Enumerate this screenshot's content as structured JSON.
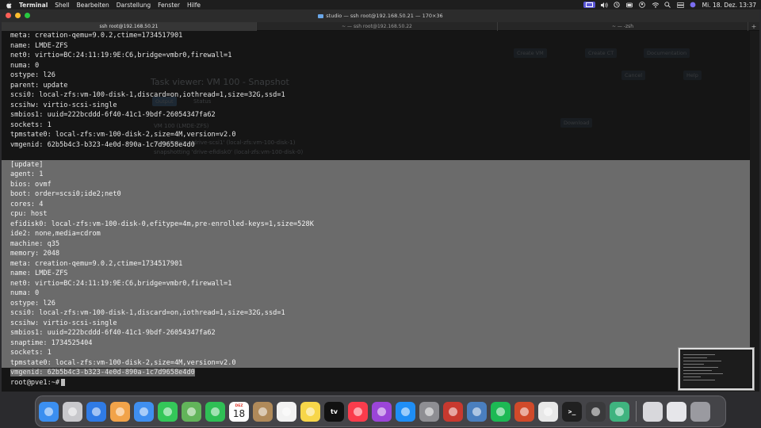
{
  "menubar": {
    "app_name": "Terminal",
    "items": [
      "Shell",
      "Bearbeiten",
      "Darstellung",
      "Fenster",
      "Hilfe"
    ],
    "clock": "Mi. 18. Dez.  13:37"
  },
  "window": {
    "title": "studio — ssh root@192.168.50.21 — 170×36",
    "tabs": [
      {
        "label": "ssh root@192.168.50.21",
        "active": true
      },
      {
        "label": "~ — ssh root@192.168.50.22",
        "active": false
      },
      {
        "label": "~ — -zsh",
        "active": false
      }
    ]
  },
  "terminal": {
    "lines": [
      {
        "text": "meta: creation-qemu=9.0.2,ctime=1734517901",
        "selected": false
      },
      {
        "text": "name: LMDE-ZFS",
        "selected": false
      },
      {
        "text": "net0: virtio=BC:24:11:19:9E:C6,bridge=vmbr0,firewall=1",
        "selected": false
      },
      {
        "text": "numa: 0",
        "selected": false
      },
      {
        "text": "ostype: l26",
        "selected": false
      },
      {
        "text": "parent: update",
        "selected": false
      },
      {
        "text": "scsi0: local-zfs:vm-100-disk-1,discard=on,iothread=1,size=32G,ssd=1",
        "selected": false
      },
      {
        "text": "scsihw: virtio-scsi-single",
        "selected": false
      },
      {
        "text": "smbios1: uuid=222bcddd-6f40-41c1-9bdf-26054347fa62",
        "selected": false
      },
      {
        "text": "sockets: 1",
        "selected": false
      },
      {
        "text": "tpmstate0: local-zfs:vm-100-disk-2,size=4M,version=v2.0",
        "selected": false
      },
      {
        "text": "vmgenid: 62b5b4c3-b323-4e0d-890a-1c7d9658e4d0",
        "selected": false
      },
      {
        "text": "",
        "selected": false
      },
      {
        "text": "[update]",
        "selected": true
      },
      {
        "text": "agent: 1",
        "selected": true
      },
      {
        "text": "bios: ovmf",
        "selected": true
      },
      {
        "text": "boot: order=scsi0;ide2;net0",
        "selected": true
      },
      {
        "text": "cores: 4",
        "selected": true
      },
      {
        "text": "cpu: host",
        "selected": true
      },
      {
        "text": "efidisk0: local-zfs:vm-100-disk-0,efitype=4m,pre-enrolled-keys=1,size=528K",
        "selected": true
      },
      {
        "text": "ide2: none,media=cdrom",
        "selected": true
      },
      {
        "text": "machine: q35",
        "selected": true
      },
      {
        "text": "memory: 2048",
        "selected": true
      },
      {
        "text": "meta: creation-qemu=9.0.2,ctime=1734517901",
        "selected": true
      },
      {
        "text": "name: LMDE-ZFS",
        "selected": true
      },
      {
        "text": "net0: virtio=BC:24:11:19:9E:C6,bridge=vmbr0,firewall=1",
        "selected": true
      },
      {
        "text": "numa: 0",
        "selected": true
      },
      {
        "text": "ostype: l26",
        "selected": true
      },
      {
        "text": "scsi0: local-zfs:vm-100-disk-1,discard=on,iothread=1,size=32G,ssd=1",
        "selected": true
      },
      {
        "text": "scsihw: virtio-scsi-single",
        "selected": true
      },
      {
        "text": "smbios1: uuid=222bcddd-6f40-41c1-9bdf-26054347fa62",
        "selected": true
      },
      {
        "text": "snaptime: 1734525404",
        "selected": true
      },
      {
        "text": "sockets: 1",
        "selected": true
      },
      {
        "text": "tpmstate0: local-zfs:vm-100-disk-2,size=4M,version=v2.0",
        "selected": true
      },
      {
        "text": "vmgenid: 62b5b4c3-b323-4e0d-890a-1c7d9658e4d0",
        "selected": "partial"
      }
    ],
    "prompt": "root@pve1:~#"
  },
  "background_window": {
    "task_viewer_title": "Task viewer: VM 100 - Snapshot",
    "tab_output": "Output",
    "tab_status": "Status",
    "download_label": "Download",
    "create_vm": "Create VM",
    "create_ct": "Create CT",
    "documentation": "Documentation",
    "cancel": "Cancel",
    "help": "Help",
    "ghost_line_1": "VM 100 (LMDE-ZFS)",
    "ghost_line_2": "snapshotting 'drive-scsi1' (local-zfs:vm-100-disk-1)",
    "ghost_line_3": "snapshotting 'drive-efidisk0' (local-zfs:vm-100-disk-0)"
  },
  "dock": {
    "apps": [
      {
        "name": "finder-icon",
        "label": "",
        "color": "#3b8ff0"
      },
      {
        "name": "launchpad-icon",
        "label": "",
        "color": "#c8c8cc"
      },
      {
        "name": "safari-icon",
        "label": "",
        "color": "#2f7be6"
      },
      {
        "name": "photos-icon",
        "label": "",
        "color": "#f1a34a"
      },
      {
        "name": "mail-icon",
        "label": "",
        "color": "#3f8ff0"
      },
      {
        "name": "messages-icon",
        "label": "",
        "color": "#34c759"
      },
      {
        "name": "maps-icon",
        "label": "",
        "color": "#62b45a"
      },
      {
        "name": "facetime-icon",
        "label": "",
        "color": "#2fbf55"
      },
      {
        "name": "calendar-icon",
        "label": "",
        "color": "#ffffff"
      },
      {
        "name": "contacts-icon",
        "label": "",
        "color": "#b08a5a"
      },
      {
        "name": "reminders-icon",
        "label": "",
        "color": "#f2f2f2"
      },
      {
        "name": "notes-icon",
        "label": "",
        "color": "#f7d64a"
      },
      {
        "name": "tv-icon",
        "label": "tv",
        "color": "#111111"
      },
      {
        "name": "music-icon",
        "label": "",
        "color": "#fa3c4c"
      },
      {
        "name": "podcasts-icon",
        "label": "",
        "color": "#9b45d8"
      },
      {
        "name": "app-store-icon",
        "label": "",
        "color": "#1f8ef5"
      },
      {
        "name": "system-settings-icon",
        "label": "",
        "color": "#8e8e93"
      },
      {
        "name": "vpn-icon",
        "label": "",
        "color": "#c8392f"
      },
      {
        "name": "quicktime-icon",
        "label": "",
        "color": "#4a7fbf"
      },
      {
        "name": "spotify-icon",
        "label": "",
        "color": "#1db954"
      },
      {
        "name": "game-icon",
        "label": "",
        "color": "#d04a2a"
      },
      {
        "name": "chrome-icon",
        "label": "",
        "color": "#e8e8e8"
      },
      {
        "name": "terminal-icon",
        "label": ">_",
        "color": "#202020"
      },
      {
        "name": "calculator-icon",
        "label": "",
        "color": "#3a3a3c"
      },
      {
        "name": "sync-icon",
        "label": "",
        "color": "#3fb37f"
      }
    ],
    "calendar_month": "DEZ",
    "calendar_day": "18"
  }
}
